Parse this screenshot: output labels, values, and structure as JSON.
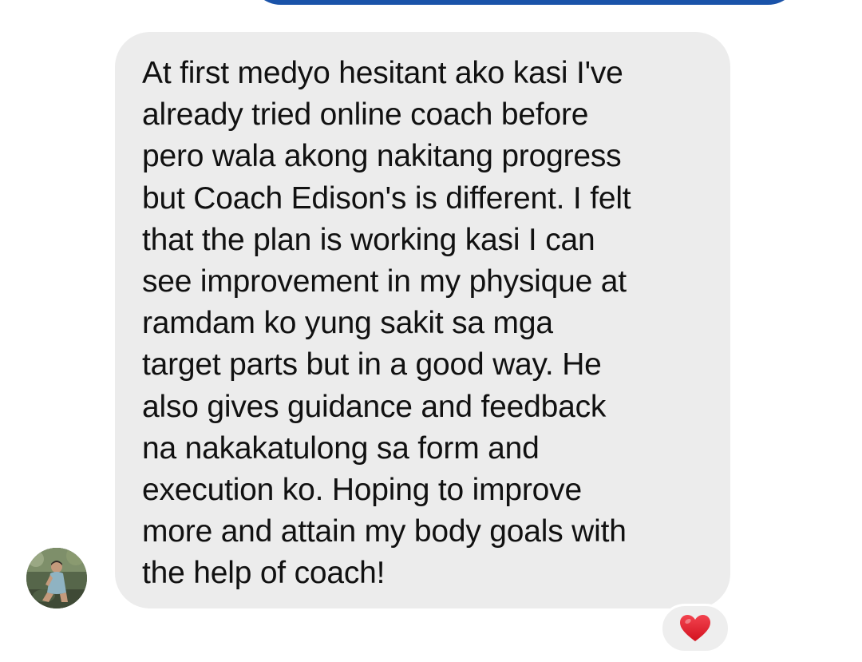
{
  "conversation": {
    "incoming_message": {
      "text": "At first medyo hesitant ako kasi I've\nalready tried online coach before\npero wala akong nakitang progress\nbut Coach Edison's is different. I felt\nthat the plan is working kasi I can\nsee improvement in my physique at\nramdam ko yung sakit sa mga\ntarget parts but in a good way. He\nalso gives guidance and feedback\nna nakakatulong sa form and\nexecution ko. Hoping to improve\nmore and attain my body goals with\nthe help of coach!",
      "bubble_color": "#ececec",
      "text_color": "#111111"
    },
    "reaction": {
      "icon": "heart-icon",
      "color": "#e8222f"
    },
    "sender_avatar": {
      "icon": "avatar-photo"
    },
    "outgoing_bubble_color": "#1a53a9"
  }
}
